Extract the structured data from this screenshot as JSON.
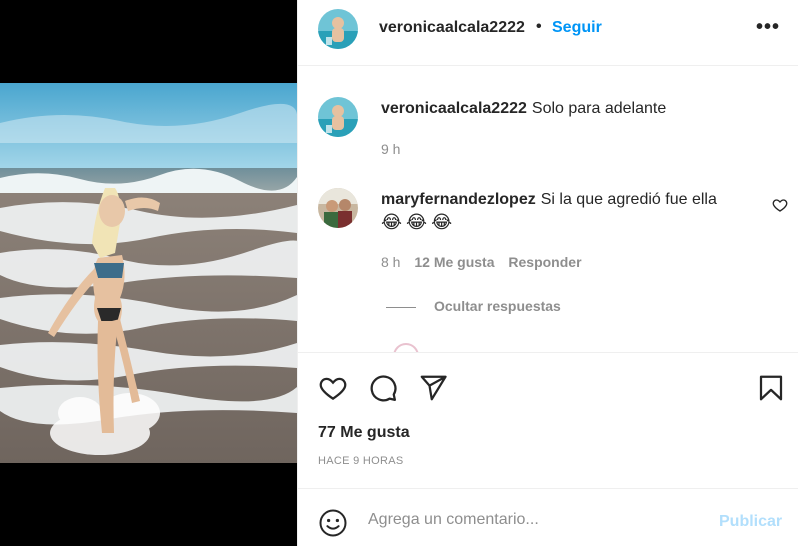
{
  "post": {
    "author": "veronicaalcala2222",
    "separator": "•",
    "follow_label": "Seguir",
    "more_label": "•••"
  },
  "caption": {
    "author": "veronicaalcala2222",
    "text": "Solo para adelante",
    "time": "9 h"
  },
  "comments": [
    {
      "author": "maryfernandezlopez",
      "text": "Si la que agredió fue ella",
      "emojis": "😂😂😂",
      "time": "8 h",
      "likes": "12 Me gusta",
      "reply_label": "Responder"
    }
  ],
  "replies": {
    "hide_label": "Ocultar respuestas"
  },
  "actions": {
    "like_icon": "heart-icon",
    "comment_icon": "comment-icon",
    "share_icon": "share-icon",
    "save_icon": "bookmark-icon"
  },
  "stats": {
    "likes": "77 Me gusta",
    "posted": "HACE 9 HORAS"
  },
  "composer": {
    "placeholder": "Agrega un comentario...",
    "value": "",
    "publish_label": "Publicar"
  },
  "colors": {
    "accent": "#0095f6",
    "publish_disabled": "#b2dffc",
    "muted": "#8e8e8e",
    "text": "#262626"
  }
}
